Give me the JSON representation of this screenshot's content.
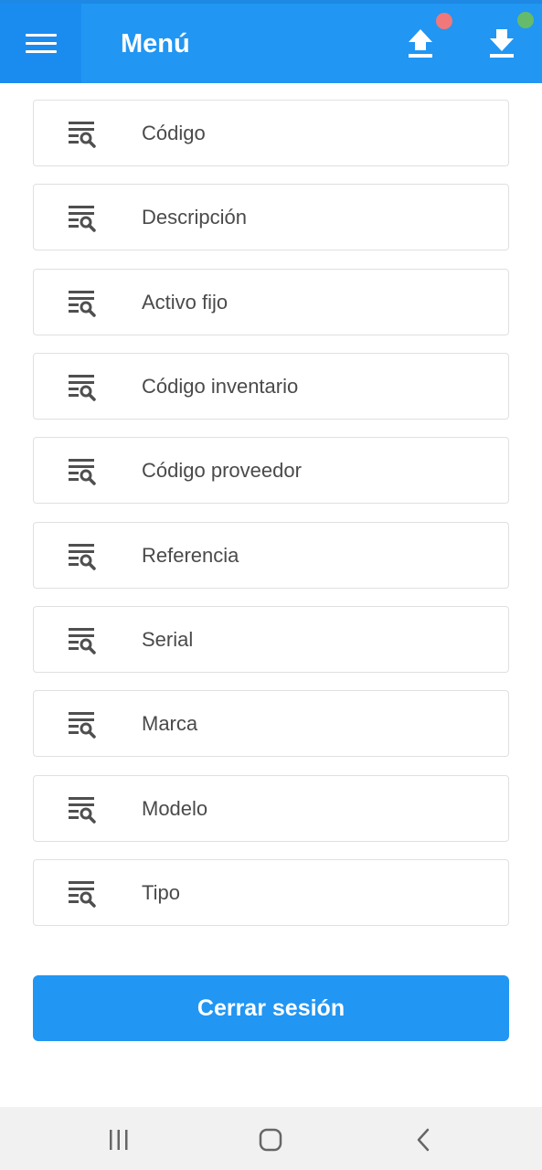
{
  "appbar": {
    "title": "Menú",
    "menu_icon": "hamburger-menu-icon",
    "upload_icon": "upload-icon",
    "download_icon": "download-icon",
    "upload_status_color": "#f0787a",
    "download_status_color": "#66bb6a",
    "bg_color": "#2196f3"
  },
  "menu_items": [
    {
      "label": "Código",
      "icon": "filter-search-icon"
    },
    {
      "label": "Descripción",
      "icon": "filter-search-icon"
    },
    {
      "label": "Activo fijo",
      "icon": "filter-search-icon"
    },
    {
      "label": "Código inventario",
      "icon": "filter-search-icon"
    },
    {
      "label": "Código proveedor",
      "icon": "filter-search-icon"
    },
    {
      "label": "Referencia",
      "icon": "filter-search-icon"
    },
    {
      "label": "Serial",
      "icon": "filter-search-icon"
    },
    {
      "label": "Marca",
      "icon": "filter-search-icon"
    },
    {
      "label": "Modelo",
      "icon": "filter-search-icon"
    },
    {
      "label": "Tipo",
      "icon": "filter-search-icon"
    }
  ],
  "logout": {
    "label": "Cerrar sesión"
  },
  "system_nav": {
    "recents_icon": "recent-apps-icon",
    "home_icon": "home-icon",
    "back_icon": "back-icon"
  }
}
